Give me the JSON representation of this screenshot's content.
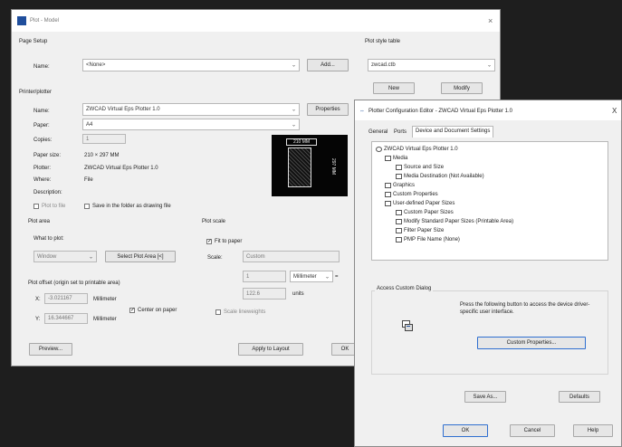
{
  "plot_dialog": {
    "title": "Plot - Model",
    "page_setup": {
      "group_label": "Page Setup",
      "name_label": "Name:",
      "name_value": "<None>",
      "add_button": "Add..."
    },
    "printer": {
      "group_label": "Printer/plotter",
      "name_label": "Name:",
      "name_value": "ZWCAD Virtual Eps Plotter 1.0",
      "properties_button": "Properties",
      "paper_label": "Paper:",
      "paper_value": "A4",
      "copies_label": "Copies:",
      "copies_value": "1",
      "paper_size_label": "Paper size:",
      "paper_size_value": "210 × 297 MM",
      "plotter_label": "Plotter:",
      "plotter_value": "ZWCAD Virtual Eps Plotter 1.0",
      "where_label": "Where:",
      "where_value": "File",
      "description_label": "Description:",
      "plot_to_file": "Plot to file",
      "save_drawing_folder": "Save in the folder as drawing file",
      "preview_width": "210 MM",
      "preview_height": "297 MM"
    },
    "plot_style": {
      "group_label": "Plot style table",
      "value": "zwcad.ctb",
      "new_button": "New",
      "modify_button": "Modify"
    },
    "plot_area": {
      "group_label": "Plot area",
      "what_to_plot_label": "What to plot:",
      "what_to_plot_value": "Window",
      "select_area_button": "Select Plot Area [<]"
    },
    "plot_scale": {
      "group_label": "Plot scale",
      "fit_to_paper": "Fit to paper",
      "scale_label": "Scale:",
      "scale_value": "Custom",
      "value1": "1",
      "unit_value": "Millimeter",
      "equals": "=",
      "value2": "122.6",
      "units_label": "units",
      "scale_lineweights": "Scale lineweights"
    },
    "plot_offset": {
      "group_label": "Plot offset (origin set to printable area)",
      "x_label": "X:",
      "x_value": "-3.021167",
      "x_unit": "Millimeter",
      "y_label": "Y:",
      "y_value": "16.344667",
      "y_unit": "Millimeter",
      "center_on_paper": "Center on paper"
    },
    "footer": {
      "preview_button": "Preview...",
      "apply_layout_button": "Apply to Layout",
      "ok_button": "OK"
    },
    "close_glyph": "×"
  },
  "pce_dialog": {
    "title": "Plotter Configuration Editor - ZWCAD Virtual Eps Plotter 1.0",
    "close_glyph": "X",
    "tabs": [
      "General",
      "Ports",
      "Device and Document Settings"
    ],
    "tree": [
      {
        "label": "ZWCAD Virtual Eps Plotter 1.0",
        "level": 0
      },
      {
        "label": "Media",
        "level": 1
      },
      {
        "label": "Source and Size",
        "level": 2
      },
      {
        "label": "Media Destination (Not Available)",
        "level": 2
      },
      {
        "label": "Graphics",
        "level": 1
      },
      {
        "label": "Custom Properties",
        "level": 1
      },
      {
        "label": "User-defined Paper Sizes",
        "level": 1
      },
      {
        "label": "Custom Paper Sizes",
        "level": 2
      },
      {
        "label": "Modify Standard Paper Sizes (Printable Area)",
        "level": 2
      },
      {
        "label": "Filter Paper Size",
        "level": 2
      },
      {
        "label": "PMP File Name (None)",
        "level": 2
      }
    ],
    "access_group_label": "Access Custom Dialog",
    "access_description": "Press the following button to access the device driver-specific user interface.",
    "custom_properties_button": "Custom Properties...",
    "save_as_button": "Save As...",
    "defaults_button": "Defaults",
    "ok_button": "OK",
    "cancel_button": "Cancel",
    "help_button": "Help"
  }
}
